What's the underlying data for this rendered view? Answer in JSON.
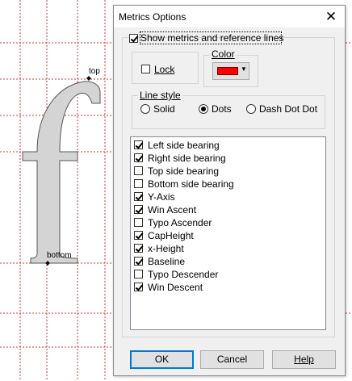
{
  "glyph": {
    "top_label": "top",
    "bottom_label": "bottom",
    "fill_color": "#d4d4d4",
    "guide_color": "#e03030"
  },
  "dialog": {
    "title": "Metrics Options",
    "show_metrics_label": "Show metrics and reference lines",
    "show_metrics_checked": true,
    "lock_label": "Lock",
    "lock_checked": false,
    "color_group_label": "Color",
    "color_value": "#ff0000",
    "line_style_label": "Line style",
    "line_styles": [
      {
        "label": "Solid",
        "selected": false
      },
      {
        "label": "Dots",
        "selected": true
      },
      {
        "label": "Dash Dot Dot",
        "selected": false
      }
    ],
    "metrics": [
      {
        "label": "Left side bearing",
        "checked": true
      },
      {
        "label": "Right side bearing",
        "checked": true
      },
      {
        "label": "Top side bearing",
        "checked": false
      },
      {
        "label": "Bottom side bearing",
        "checked": false
      },
      {
        "label": "Y-Axis",
        "checked": true
      },
      {
        "label": "Win Ascent",
        "checked": true
      },
      {
        "label": "Typo Ascender",
        "checked": false
      },
      {
        "label": "CapHeight",
        "checked": true
      },
      {
        "label": "x-Height",
        "checked": true
      },
      {
        "label": "Baseline",
        "checked": true
      },
      {
        "label": "Typo Descender",
        "checked": false
      },
      {
        "label": "Win Descent",
        "checked": true
      }
    ],
    "ok_label": "OK",
    "cancel_label": "Cancel",
    "help_label": "Help"
  }
}
